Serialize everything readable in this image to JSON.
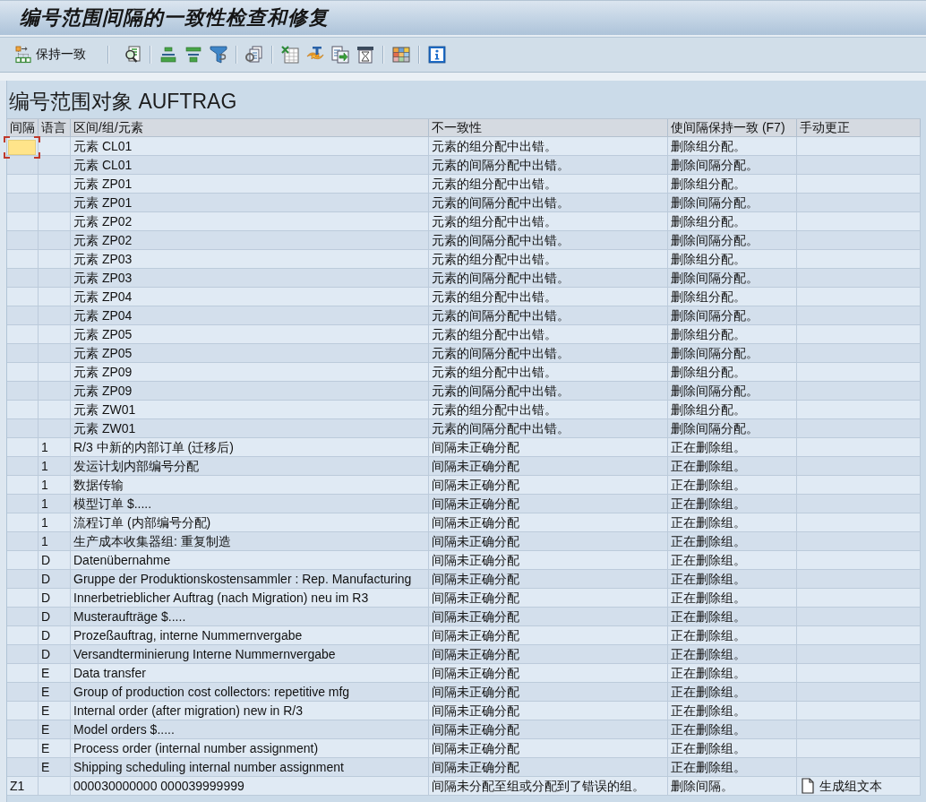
{
  "window": {
    "title": "编号范围间隔的一致性检查和修复"
  },
  "toolbar": {
    "buttons": [
      {
        "label": "保持一致"
      }
    ]
  },
  "heading": "编号范围对象 AUFTRAG",
  "table": {
    "columns": [
      "间隔",
      "语言",
      "区间/组/元素",
      "不一致性",
      "使间隔保持一致 (F7)",
      "手动更正"
    ],
    "rows": [
      {
        "element": "元素 CL01",
        "inconsistency": "元素的组分配中出错。",
        "fix": "删除组分配。",
        "focused": true
      },
      {
        "element": "元素 CL01",
        "inconsistency": "元素的间隔分配中出错。",
        "fix": "删除间隔分配。",
        "focused": false
      },
      {
        "element": "元素 ZP01",
        "inconsistency": "元素的组分配中出错。",
        "fix": "删除组分配。",
        "focused": false
      },
      {
        "element": "元素 ZP01",
        "inconsistency": "元素的间隔分配中出错。",
        "fix": "删除间隔分配。",
        "focused": false
      },
      {
        "element": "元素 ZP02",
        "inconsistency": "元素的组分配中出错。",
        "fix": "删除组分配。",
        "focused": false
      },
      {
        "element": "元素 ZP02",
        "inconsistency": "元素的间隔分配中出错。",
        "fix": "删除间隔分配。",
        "focused": false
      },
      {
        "element": "元素 ZP03",
        "inconsistency": "元素的组分配中出错。",
        "fix": "删除组分配。",
        "focused": false
      },
      {
        "element": "元素 ZP03",
        "inconsistency": "元素的间隔分配中出错。",
        "fix": "删除间隔分配。",
        "focused": false
      },
      {
        "element": "元素 ZP04",
        "inconsistency": "元素的组分配中出错。",
        "fix": "删除组分配。",
        "focused": false
      },
      {
        "element": "元素 ZP04",
        "inconsistency": "元素的间隔分配中出错。",
        "fix": "删除间隔分配。",
        "focused": false
      },
      {
        "element": "元素 ZP05",
        "inconsistency": "元素的组分配中出错。",
        "fix": "删除组分配。",
        "focused": false
      },
      {
        "element": "元素 ZP05",
        "inconsistency": "元素的间隔分配中出错。",
        "fix": "删除间隔分配。",
        "focused": false
      },
      {
        "element": "元素 ZP09",
        "inconsistency": "元素的组分配中出错。",
        "fix": "删除组分配。",
        "focused": false
      },
      {
        "element": "元素 ZP09",
        "inconsistency": "元素的间隔分配中出错。",
        "fix": "删除间隔分配。",
        "focused": false
      },
      {
        "element": "元素 ZW01",
        "inconsistency": "元素的组分配中出错。",
        "fix": "删除组分配。",
        "focused": false
      },
      {
        "element": "元素 ZW01",
        "inconsistency": "元素的间隔分配中出错。",
        "fix": "删除间隔分配。",
        "focused": false
      },
      {
        "language": "1",
        "element": "R/3 中新的内部订单 (迁移后)",
        "inconsistency": "间隔未正确分配",
        "fix": "正在删除组。",
        "focused": false
      },
      {
        "language": "1",
        "element": "发运计划内部编号分配",
        "inconsistency": "间隔未正确分配",
        "fix": "正在删除组。",
        "focused": false
      },
      {
        "language": "1",
        "element": "数据传输",
        "inconsistency": "间隔未正确分配",
        "fix": "正在删除组。",
        "focused": false
      },
      {
        "language": "1",
        "element": "模型订单 $.....",
        "inconsistency": "间隔未正确分配",
        "fix": "正在删除组。",
        "focused": false
      },
      {
        "language": "1",
        "element": "流程订单 (内部编号分配)",
        "inconsistency": "间隔未正确分配",
        "fix": "正在删除组。",
        "focused": false
      },
      {
        "language": "1",
        "element": "生产成本收集器组: 重复制造",
        "inconsistency": "间隔未正确分配",
        "fix": "正在删除组。",
        "focused": false
      },
      {
        "language": "D",
        "element": "Datenübernahme",
        "inconsistency": "间隔未正确分配",
        "fix": "正在删除组。",
        "focused": false
      },
      {
        "language": "D",
        "element": "Gruppe der Produktionskostensammler : Rep. Manufacturing",
        "inconsistency": "间隔未正确分配",
        "fix": "正在删除组。",
        "focused": false
      },
      {
        "language": "D",
        "element": "Innerbetrieblicher Auftrag (nach Migration) neu im R3",
        "inconsistency": "间隔未正确分配",
        "fix": "正在删除组。",
        "focused": false
      },
      {
        "language": "D",
        "element": "Musteraufträge $.....",
        "inconsistency": "间隔未正确分配",
        "fix": "正在删除组。",
        "focused": false
      },
      {
        "language": "D",
        "element": "Prozeßauftrag, interne Nummernvergabe",
        "inconsistency": "间隔未正确分配",
        "fix": "正在删除组。",
        "focused": false
      },
      {
        "language": "D",
        "element": "Versandterminierung Interne Nummernvergabe",
        "inconsistency": "间隔未正确分配",
        "fix": "正在删除组。",
        "focused": false
      },
      {
        "language": "E",
        "element": "Data transfer",
        "inconsistency": "间隔未正确分配",
        "fix": "正在删除组。",
        "focused": false
      },
      {
        "language": "E",
        "element": "Group of production cost collectors: repetitive mfg",
        "inconsistency": "间隔未正确分配",
        "fix": "正在删除组。",
        "focused": false
      },
      {
        "language": "E",
        "element": "Internal order (after migration) new in R/3",
        "inconsistency": "间隔未正确分配",
        "fix": "正在删除组。",
        "focused": false
      },
      {
        "language": "E",
        "element": "Model orders $.....",
        "inconsistency": "间隔未正确分配",
        "fix": "正在删除组。",
        "focused": false
      },
      {
        "language": "E",
        "element": "Process order (internal number assignment)",
        "inconsistency": "间隔未正确分配",
        "fix": "正在删除组。",
        "focused": false
      },
      {
        "language": "E",
        "element": "Shipping scheduling internal number assignment",
        "inconsistency": "间隔未正确分配",
        "fix": "正在删除组。",
        "focused": false
      },
      {
        "interval": "Z1",
        "element": "000030000000 000039999999",
        "inconsistency": "间隔未分配至组或分配到了错误的组。",
        "fix": "删除间隔。",
        "manual_correction": "生成组文本",
        "focused": false
      }
    ]
  }
}
